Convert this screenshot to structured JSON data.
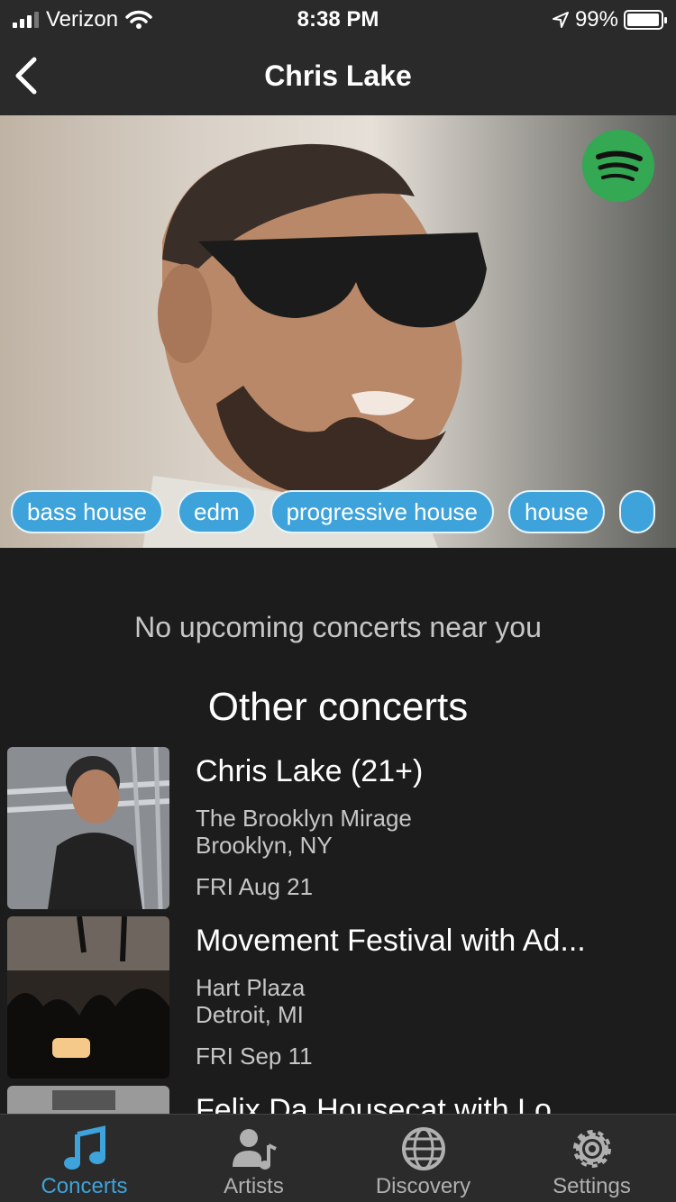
{
  "status_bar": {
    "carrier": "Verizon",
    "time": "8:38 PM",
    "battery": "99%",
    "battery_level": 0.99
  },
  "nav": {
    "title": "Chris Lake"
  },
  "hero": {
    "tags": [
      "bass house",
      "edm",
      "progressive house",
      "house"
    ]
  },
  "main": {
    "no_upcoming": "No upcoming concerts near you",
    "other_title": "Other concerts",
    "concerts": [
      {
        "name": "Chris Lake (21+)",
        "venue": "The Brooklyn Mirage",
        "city": "Brooklyn, NY",
        "date": "FRI Aug 21"
      },
      {
        "name": "Movement Festival with Ad...",
        "venue": "Hart Plaza",
        "city": "Detroit, MI",
        "date": "FRI Sep 11"
      },
      {
        "name": "Felix Da Housecat with Lo..."
      }
    ]
  },
  "tab_bar": {
    "tabs": [
      {
        "label": "Concerts",
        "icon": "music-note-icon",
        "active": true
      },
      {
        "label": "Artists",
        "icon": "artists-icon",
        "active": false
      },
      {
        "label": "Discovery",
        "icon": "globe-icon",
        "active": false
      },
      {
        "label": "Settings",
        "icon": "gear-icon",
        "active": false
      }
    ]
  },
  "colors": {
    "accent": "#3ea3da",
    "background": "#1c1c1c",
    "bars": "#2a2a2a",
    "spotify": "#34a853"
  }
}
